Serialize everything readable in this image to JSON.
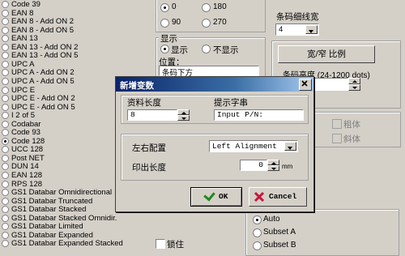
{
  "symbologies": [
    {
      "label": "Code 39",
      "selected": false
    },
    {
      "label": "EAN 8",
      "selected": false
    },
    {
      "label": "EAN 8 - Add ON 2",
      "selected": false
    },
    {
      "label": "EAN 8 - Add ON 5",
      "selected": false
    },
    {
      "label": "EAN 13",
      "selected": false
    },
    {
      "label": "EAN 13 - Add ON 2",
      "selected": false
    },
    {
      "label": "EAN 13 - Add ON 5",
      "selected": false
    },
    {
      "label": "UPC A",
      "selected": false
    },
    {
      "label": "UPC A - Add ON 2",
      "selected": false
    },
    {
      "label": "UPC A - Add ON 5",
      "selected": false
    },
    {
      "label": "UPC E",
      "selected": false
    },
    {
      "label": "UPC E - Add ON 2",
      "selected": false
    },
    {
      "label": "UPC E - Add ON 5",
      "selected": false
    },
    {
      "label": "I 2 of 5",
      "selected": false
    },
    {
      "label": "Codabar",
      "selected": false
    },
    {
      "label": "Code 93",
      "selected": false
    },
    {
      "label": "Code 128",
      "selected": true
    },
    {
      "label": "UCC 128",
      "selected": false
    },
    {
      "label": "Post NET",
      "selected": false
    },
    {
      "label": "DUN 14",
      "selected": false
    },
    {
      "label": "EAN 128",
      "selected": false
    },
    {
      "label": "RPS 128",
      "selected": false
    },
    {
      "label": "GS1 Databar Omnidirectional",
      "selected": false
    },
    {
      "label": "GS1 Databar Truncated",
      "selected": false
    },
    {
      "label": "GS1 Databar Stacked",
      "selected": false
    },
    {
      "label": "GS1 Databar Stacked Omnidir.",
      "selected": false
    },
    {
      "label": "GS1 Databar Limited",
      "selected": false
    },
    {
      "label": "GS1 Databar Expanded",
      "selected": false
    },
    {
      "label": "GS1 Databar Expanded Stacked",
      "selected": false
    }
  ],
  "rotation": {
    "options": [
      {
        "label": "0",
        "selected": true
      },
      {
        "label": "180",
        "selected": false
      },
      {
        "label": "90",
        "selected": false
      },
      {
        "label": "270",
        "selected": false
      }
    ]
  },
  "narrow_bar": {
    "label": "条码细线宽",
    "value": "4"
  },
  "display": {
    "group_label": "显示",
    "show_label": "显示",
    "hide_label": "不显示",
    "position_label": "位置：",
    "position_value": "条码下方"
  },
  "ratio_button": "宽/窄 比例",
  "height": {
    "label": "条码高度 (24-1200 dots)"
  },
  "font_style": {
    "bold": "粗体",
    "italic": "斜体"
  },
  "code_subset": {
    "options": [
      {
        "label": "Auto",
        "selected": true
      },
      {
        "label": "Subset A",
        "selected": false
      },
      {
        "label": "Subset B",
        "selected": false
      }
    ]
  },
  "lock_label": "锁住",
  "dialog": {
    "title": "新增变数",
    "data_length_label": "资料长度",
    "data_length_value": "8",
    "prompt_label": "提示字串",
    "prompt_value": "Input P/N:",
    "alignment_label": "左右配置",
    "alignment_value": "Left Alignment",
    "print_length_label": "印出长度",
    "print_length_value": "0",
    "print_length_unit": "mm",
    "ok_label": "OK",
    "cancel_label": "Cancel",
    "colors": {
      "title_start": "#0a246a",
      "title_end": "#a6caf0",
      "close_bg": "#c8143c"
    }
  }
}
